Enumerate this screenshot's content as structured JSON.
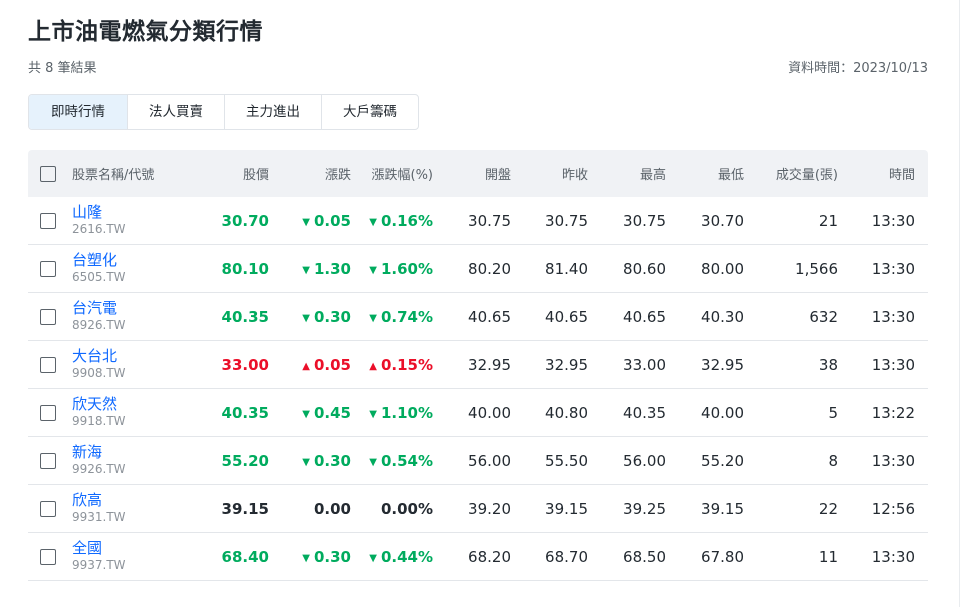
{
  "page": {
    "title": "上市油電燃氣分類行情",
    "result_count": "共 8 筆結果",
    "data_time": "資料時間：2023/10/13"
  },
  "tabs": [
    {
      "label": "即時行情",
      "active": true
    },
    {
      "label": "法人買賣",
      "active": false
    },
    {
      "label": "主力進出",
      "active": false
    },
    {
      "label": "大戶籌碼",
      "active": false
    }
  ],
  "table": {
    "headers": {
      "name": "股票名稱/代號",
      "price": "股價",
      "change": "漲跌",
      "change_pct": "漲跌幅(%)",
      "open": "開盤",
      "prev_close": "昨收",
      "high": "最高",
      "low": "最低",
      "volume": "成交量(張)",
      "time": "時間"
    },
    "rows": [
      {
        "name": "山隆",
        "symbol": "2616.TW",
        "price": "30.70",
        "change": "0.05",
        "change_pct": "0.16%",
        "direction": "down",
        "open": "30.75",
        "prev_close": "30.75",
        "high": "30.75",
        "low": "30.70",
        "volume": "21",
        "time": "13:30"
      },
      {
        "name": "台塑化",
        "symbol": "6505.TW",
        "price": "80.10",
        "change": "1.30",
        "change_pct": "1.60%",
        "direction": "down",
        "open": "80.20",
        "prev_close": "81.40",
        "high": "80.60",
        "low": "80.00",
        "volume": "1,566",
        "time": "13:30"
      },
      {
        "name": "台汽電",
        "symbol": "8926.TW",
        "price": "40.35",
        "change": "0.30",
        "change_pct": "0.74%",
        "direction": "down",
        "open": "40.65",
        "prev_close": "40.65",
        "high": "40.65",
        "low": "40.30",
        "volume": "632",
        "time": "13:30"
      },
      {
        "name": "大台北",
        "symbol": "9908.TW",
        "price": "33.00",
        "change": "0.05",
        "change_pct": "0.15%",
        "direction": "up",
        "open": "32.95",
        "prev_close": "32.95",
        "high": "33.00",
        "low": "32.95",
        "volume": "38",
        "time": "13:30"
      },
      {
        "name": "欣天然",
        "symbol": "9918.TW",
        "price": "40.35",
        "change": "0.45",
        "change_pct": "1.10%",
        "direction": "down",
        "open": "40.00",
        "prev_close": "40.80",
        "high": "40.35",
        "low": "40.00",
        "volume": "5",
        "time": "13:22"
      },
      {
        "name": "新海",
        "symbol": "9926.TW",
        "price": "55.20",
        "change": "0.30",
        "change_pct": "0.54%",
        "direction": "down",
        "open": "56.00",
        "prev_close": "55.50",
        "high": "56.00",
        "low": "55.20",
        "volume": "8",
        "time": "13:30"
      },
      {
        "name": "欣高",
        "symbol": "9931.TW",
        "price": "39.15",
        "change": "0.00",
        "change_pct": "0.00%",
        "direction": "flat",
        "open": "39.20",
        "prev_close": "39.15",
        "high": "39.25",
        "low": "39.15",
        "volume": "22",
        "time": "12:56"
      },
      {
        "name": "全國",
        "symbol": "9937.TW",
        "price": "68.40",
        "change": "0.30",
        "change_pct": "0.44%",
        "direction": "down",
        "open": "68.20",
        "prev_close": "68.70",
        "high": "68.50",
        "low": "67.80",
        "volume": "11",
        "time": "13:30"
      }
    ]
  },
  "colors": {
    "up": "#eb0f29",
    "down": "#00ab5e",
    "link": "#0f69ff",
    "active_tab": "#e6f2fc",
    "header_bg": "#f0f2f5"
  },
  "icons": {
    "up": "triangle-up-icon",
    "down": "triangle-down-icon"
  }
}
